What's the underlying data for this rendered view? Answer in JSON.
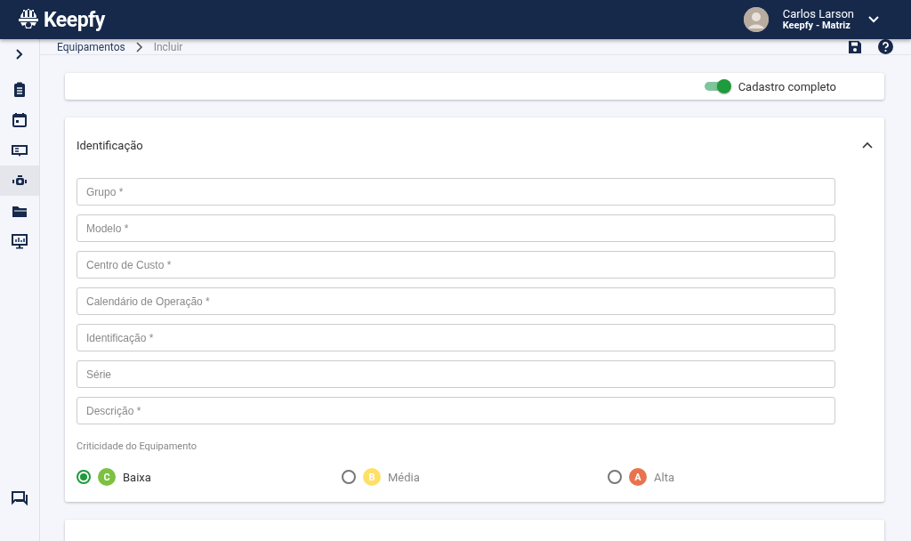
{
  "header": {
    "logo": "Keepfy",
    "user": {
      "name": "Carlos Larson",
      "company": "Keepfy - Matriz"
    }
  },
  "sidebar": {
    "items": [
      {
        "selected": false
      },
      {
        "selected": false
      },
      {
        "selected": false
      },
      {
        "selected": true
      },
      {
        "selected": false
      },
      {
        "selected": false
      }
    ]
  },
  "breadcrumb": [
    "Equipamentos",
    "Incluir"
  ],
  "toggle": {
    "label": "Cadastro completo",
    "on": true
  },
  "section": {
    "title": "Identificação",
    "expanded": true,
    "fields": [
      {
        "placeholder": "Grupo *"
      },
      {
        "placeholder": "Modelo *"
      },
      {
        "placeholder": "Centro de Custo *"
      },
      {
        "placeholder": "Calendário de Operação *"
      },
      {
        "placeholder": "Identificação *"
      },
      {
        "placeholder": "Série"
      },
      {
        "placeholder": "Descrição *"
      }
    ],
    "criticality": {
      "label": "Criticidade do Equipamento",
      "options": [
        {
          "letter": "C",
          "label": "Baixa",
          "color": "#7cc142",
          "selected": true
        },
        {
          "letter": "B",
          "label": "Média",
          "color": "#ffe066",
          "selected": false
        },
        {
          "letter": "A",
          "label": "Alta",
          "color": "#e8734e",
          "selected": false
        }
      ]
    }
  }
}
